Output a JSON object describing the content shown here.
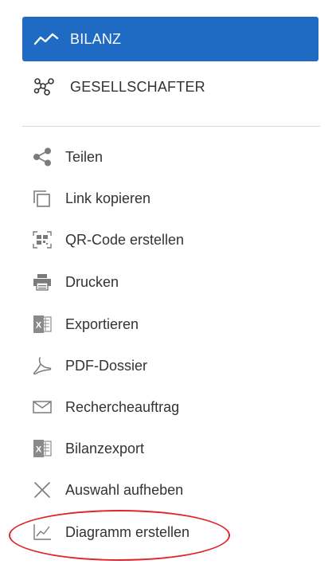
{
  "colors": {
    "accent": "#1f6bc3",
    "icon_gray": "#7b7b7b",
    "excel_gray": "#8a8a8a",
    "highlight_ring": "#e2242b"
  },
  "nav": {
    "items": [
      {
        "label": "BILANZ",
        "icon": "trend-line-icon",
        "active": true
      },
      {
        "label": "GESELLSCHAFTER",
        "icon": "network-graph-icon",
        "active": false
      }
    ]
  },
  "menu": {
    "items": [
      {
        "label": "Teilen",
        "icon": "share-icon"
      },
      {
        "label": "Link kopieren",
        "icon": "copy-icon"
      },
      {
        "label": "QR-Code erstellen",
        "icon": "qr-code-icon"
      },
      {
        "label": "Drucken",
        "icon": "printer-icon"
      },
      {
        "label": "Exportieren",
        "icon": "excel-icon"
      },
      {
        "label": "PDF-Dossier",
        "icon": "pdf-icon"
      },
      {
        "label": "Rechercheauftrag",
        "icon": "envelope-icon"
      },
      {
        "label": "Bilanzexport",
        "icon": "excel-icon"
      },
      {
        "label": "Auswahl aufheben",
        "icon": "close-icon"
      },
      {
        "label": "Diagramm erstellen",
        "icon": "chart-icon"
      }
    ]
  }
}
